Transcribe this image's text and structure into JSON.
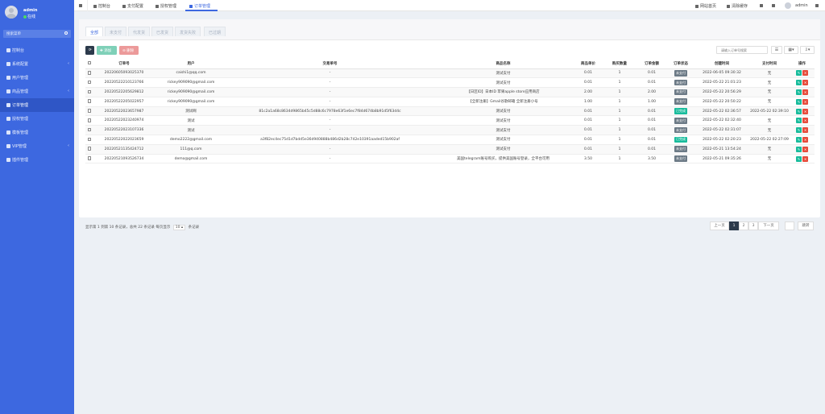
{
  "sidebar": {
    "user": {
      "name": "admin",
      "status": "在线"
    },
    "search_label": "搜索菜单",
    "items": [
      {
        "label": "控制台",
        "icon": "dashboard-icon",
        "arrow": ""
      },
      {
        "label": "系统配置",
        "icon": "gear-icon",
        "arrow": "‹"
      },
      {
        "label": "用户管理",
        "icon": "user-icon",
        "arrow": ""
      },
      {
        "label": "商品管理",
        "icon": "shop-icon",
        "arrow": "‹"
      },
      {
        "label": "订单管理",
        "icon": "order-icon",
        "arrow": ""
      },
      {
        "label": "授权管理",
        "icon": "key-icon",
        "arrow": ""
      },
      {
        "label": "模板管理",
        "icon": "template-icon",
        "arrow": ""
      },
      {
        "label": "VIP管理",
        "icon": "vip-icon",
        "arrow": "‹"
      },
      {
        "label": "插件管理",
        "icon": "plugin-icon",
        "arrow": ""
      }
    ]
  },
  "topbar": {
    "tabs": [
      "控制台",
      "支付配置",
      "授权管理",
      "订单管理"
    ],
    "right": [
      "网站首页",
      "清除缓存"
    ],
    "admin": "admin"
  },
  "panel": {
    "tabs": [
      "全部",
      "未支付",
      "代发货",
      "已发货",
      "发货失败",
      "已过期"
    ],
    "add_label": "添加",
    "del_label": "删除",
    "search_placeholder": "请输入订单号搜索"
  },
  "table": {
    "headers": [
      "订单号",
      "用户",
      "交易单号",
      "商品名称",
      "商品单价",
      "购买数量",
      "订单金额",
      "订单状态",
      "创建时间",
      "支付时间",
      "操作"
    ],
    "rows": [
      [
        "20220605093025370",
        "caishi1@qq.com",
        "-",
        "测试支付",
        "0.01",
        "1",
        "0.01",
        "未支付",
        "2022-06-05 09:30:32",
        "无"
      ],
      [
        "20220522210123766",
        "rickey909090@gmail.com",
        "-",
        "测试支付",
        "0.01",
        "1",
        "0.01",
        "未支付",
        "2022-05-22 21:01:23",
        "无"
      ],
      [
        "20220522205629812",
        "rickey909090@gmail.com",
        "-",
        "【日区ID】日本ID 苹果apple store应用商店",
        "2.00",
        "1",
        "2.00",
        "未支付",
        "2022-05-22 20:56:29",
        "无"
      ],
      [
        "20220522205022957",
        "rickey909090@gmail.com",
        "-",
        "【全新注册】Gmail谷歌邮箱 全新注册小号",
        "1.00",
        "1",
        "1.00",
        "未支付",
        "2022-05-22 20:50:22",
        "无"
      ],
      [
        "20220522023657987",
        "测试啊",
        "81c2a1a68c8634d9865b45c5d88c6c7978e63f1e6ec7f84d674b8b91d5f63d4c",
        "测试支付",
        "0.01",
        "1",
        "0.01",
        "已完成",
        "2022-05-22 02:36:57",
        "2022-05-22 02:39:10"
      ],
      [
        "20220522023240974",
        "测试",
        "-",
        "测试支付",
        "0.01",
        "1",
        "0.01",
        "未支付",
        "2022-05-22 02:32:40",
        "无"
      ],
      [
        "20220522023107336",
        "测试",
        "-",
        "测试支付",
        "0.01",
        "1",
        "0.01",
        "未支付",
        "2022-05-22 02:31:07",
        "无"
      ],
      [
        "20220522022023659",
        "demo2222@gmail.com",
        "a3f82ec4ec75d1d7bdd5e36d940888b486d2b28c742e10391aaded15b902af",
        "测试支付",
        "0.01",
        "1",
        "0.01",
        "已完成",
        "2022-05-22 02:20:23",
        "2022-05-22 02:27:09"
      ],
      [
        "20220521135424712",
        "111@q.com",
        "-",
        "测试支付",
        "0.01",
        "1",
        "0.01",
        "未支付",
        "2022-05-21 13:54:24",
        "无"
      ],
      [
        "20220521093526734",
        "demo@gmail.com",
        "-",
        "美国telegram账号购买，提供美国账号登录，全平台可用",
        "3.50",
        "1",
        "3.50",
        "未支付",
        "2022-05-21 09:35:26",
        "无"
      ]
    ]
  },
  "pagination": {
    "info_prefix": "显示第 1 到第 10 条记录，总共 22 条记录 每页显示",
    "page_size": "10",
    "info_suffix": "条记录",
    "pages": [
      "上一页",
      "1",
      "2",
      "3",
      "下一页"
    ],
    "jump_label": "跳转"
  }
}
